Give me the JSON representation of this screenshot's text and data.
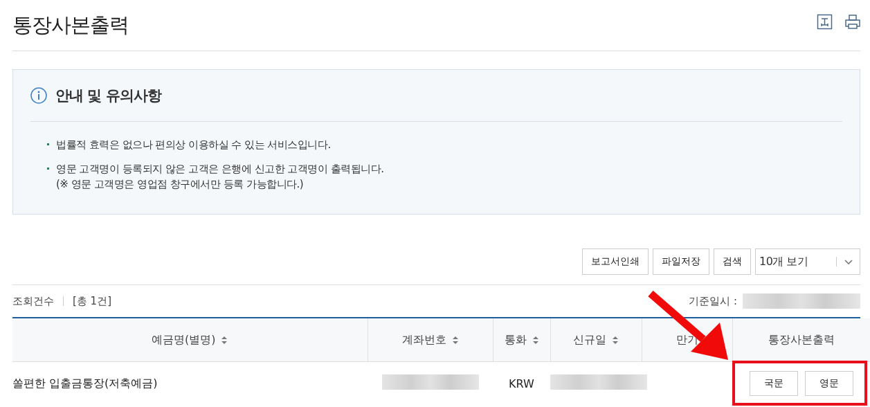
{
  "page": {
    "title": "통장사본출력"
  },
  "notice": {
    "title": "안내 및 유의사항",
    "items": [
      {
        "lines": [
          "법률적 효력은 없으나 편의상 이용하실 수 있는 서비스입니다."
        ]
      },
      {
        "lines": [
          "영문 고객명이 등록되지 않은 고객은 은행에 신고한 고객명이 출력됩니다.",
          "(※ 영문 고객명은 영업점 창구에서만 등록 가능합니다.)"
        ]
      }
    ]
  },
  "toolbar": {
    "buttons": [
      "보고서인쇄",
      "파일저장",
      "검색"
    ],
    "page_size": "10개 보기"
  },
  "summary": {
    "count_label": "조회건수",
    "count": "[총 1건]",
    "as_of_label": "기준일시 :",
    "as_of_blurred": true
  },
  "table": {
    "columns": [
      {
        "label": "예금명(별명)",
        "sortable": true
      },
      {
        "label": "계좌번호",
        "sortable": true
      },
      {
        "label": "통화",
        "sortable": true
      },
      {
        "label": "신규일",
        "sortable": true
      },
      {
        "label": "만기",
        "sortable": false
      },
      {
        "label": "통장사본출력",
        "sortable": false
      }
    ],
    "rows": [
      {
        "cells": [
          {
            "kind": "text",
            "text": "쏠편한 입출금통장(저축예금)"
          },
          {
            "kind": "blurred"
          },
          {
            "kind": "text",
            "text": "KRW"
          },
          {
            "kind": "blurred"
          },
          {
            "kind": "empty"
          },
          {
            "kind": "buttons",
            "buttons": [
              "국문",
              "영문"
            ]
          }
        ]
      }
    ]
  },
  "annotations": {
    "arrow": true,
    "highlight_box": true
  }
}
